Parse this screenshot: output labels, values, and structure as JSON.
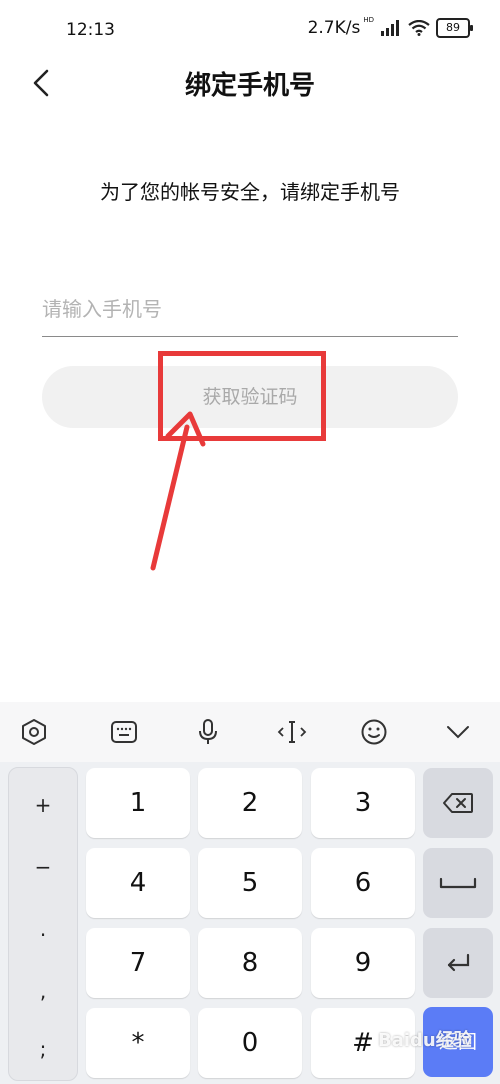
{
  "status_bar": {
    "time": "12:13",
    "net_speed": "2.7K/s",
    "hd_label": "HD",
    "battery": "89"
  },
  "header": {
    "title": "绑定手机号"
  },
  "subtitle": "为了您的帐号安全，请绑定手机号",
  "phone_input": {
    "placeholder": "请输入手机号",
    "value": ""
  },
  "code_button": {
    "label": "获取验证码"
  },
  "colors": {
    "annotation_red": "#e83a3a",
    "return_key_blue": "#5b7cf6",
    "button_bg": "#f1f1f1"
  },
  "keyboard": {
    "toolbar_icons": [
      "hexagon-settings-icon",
      "keyboard-icon",
      "microphone-icon",
      "cursor-icon",
      "emoji-icon",
      "chevron-down-icon"
    ],
    "symbols": [
      "+",
      "−",
      ".",
      ",",
      ";"
    ],
    "keys": [
      "1",
      "2",
      "3",
      "4",
      "5",
      "6",
      "7",
      "8",
      "9",
      "*",
      "0",
      "#"
    ],
    "return_label": "返回"
  },
  "watermark": "Baidu经验"
}
